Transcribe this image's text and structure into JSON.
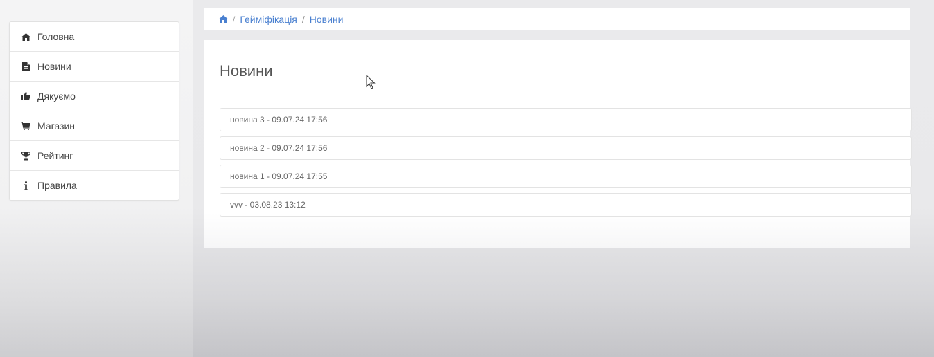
{
  "sidebar": {
    "items": [
      {
        "label": "Головна",
        "icon": "home-icon"
      },
      {
        "label": "Новини",
        "icon": "document-icon"
      },
      {
        "label": "Дякуємо",
        "icon": "thumbs-up-icon"
      },
      {
        "label": "Магазин",
        "icon": "cart-icon"
      },
      {
        "label": "Рейтинг",
        "icon": "trophy-icon"
      },
      {
        "label": "Правила",
        "icon": "info-icon"
      }
    ]
  },
  "breadcrumb": {
    "home_icon": "home-icon",
    "separator": "/",
    "items": [
      "Гейміфікація",
      "Новини"
    ]
  },
  "main": {
    "title": "Новини",
    "news": [
      "новина 3 - 09.07.24 17:56",
      "новина 2 - 09.07.24 17:56",
      "новина 1 - 09.07.24 17:55",
      "vvv - 03.08.23 13:12"
    ]
  },
  "colors": {
    "link": "#4a80d0",
    "text": "#444444"
  }
}
